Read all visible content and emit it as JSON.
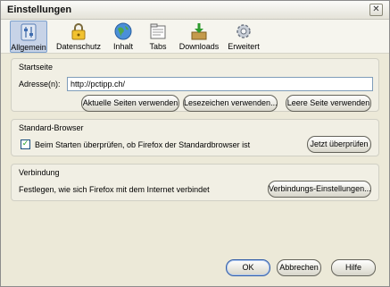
{
  "window": {
    "title": "Einstellungen",
    "close_glyph": "✕"
  },
  "toolbar": {
    "items": [
      {
        "label": "Allgemein",
        "icon": "general-sliders-icon",
        "active": true
      },
      {
        "label": "Datenschutz",
        "icon": "lock-icon",
        "active": false
      },
      {
        "label": "Inhalt",
        "icon": "globe-icon",
        "active": false
      },
      {
        "label": "Tabs",
        "icon": "tabs-icon",
        "active": false
      },
      {
        "label": "Downloads",
        "icon": "download-box-icon",
        "active": false
      },
      {
        "label": "Erweitert",
        "icon": "gear-icon",
        "active": false
      }
    ]
  },
  "startseite": {
    "title": "Startseite",
    "address_label": "Adresse(n):",
    "address_value": "http://pctipp.ch/",
    "buttons": {
      "current": "Aktuelle Seiten verwenden",
      "bookmark": "Lesezeichen verwenden...",
      "blank": "Leere Seite verwenden"
    }
  },
  "browser": {
    "title": "Standard-Browser",
    "checkbox_label": "Beim Starten überprüfen, ob Firefox der Standardbrowser ist",
    "checked": true,
    "check_now_button": "Jetzt überprüfen"
  },
  "connection": {
    "title": "Verbindung",
    "description": "Festlegen, wie sich Firefox mit dem Internet verbindet",
    "settings_button": "Verbindungs-Einstellungen..."
  },
  "footer": {
    "ok": "OK",
    "cancel": "Abbrechen",
    "help": "Hilfe"
  },
  "colors": {
    "accent": "#335ea8",
    "dialog_bg": "#ece9d8",
    "active_tab_bg": "#c7d3e7"
  }
}
